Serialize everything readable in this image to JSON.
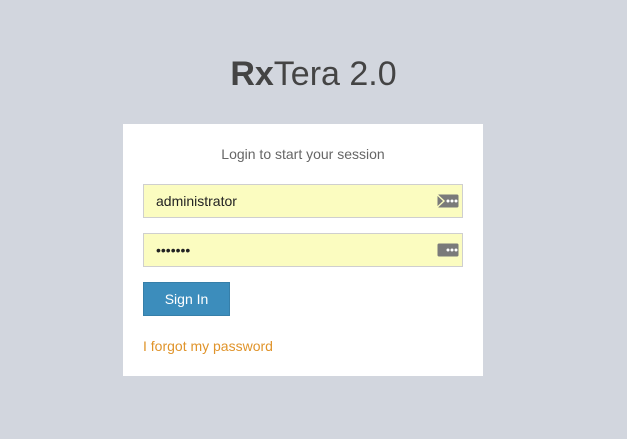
{
  "logo": {
    "bold": "Rx",
    "light": "Tera 2.0"
  },
  "login": {
    "message": "Login to start your session",
    "username_value": "administrator",
    "password_value": "•••••••",
    "signin_label": "Sign In",
    "forgot_label": "I forgot my password"
  },
  "colors": {
    "background": "#d2d6de",
    "input_autofill": "#fbfcc0",
    "button": "#3c8dbc",
    "link": "#e0942b"
  },
  "icons": {
    "username_field": "envelope-dots-icon",
    "password_field": "lock-dots-icon"
  }
}
